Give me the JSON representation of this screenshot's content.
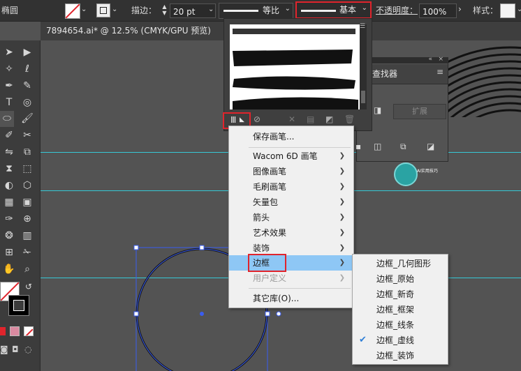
{
  "control_bar": {
    "app_fragment": "椭圆",
    "stroke_label": "描边：",
    "stroke_value": "20 pt",
    "profile_label": "等比",
    "brush_label": "基本",
    "opacity_label": "不透明度：",
    "opacity_value": "100%",
    "style_label": "样式："
  },
  "document_tab": {
    "title": "7894654.ai* @ 12.5% (CMYK/GPU 预览)"
  },
  "finder_panel": {
    "title": "查找器",
    "expand_label": "扩展",
    "logo_text": "AI实用技巧"
  },
  "brush_menu": {
    "items": [
      {
        "label": "保存画笔...",
        "submenu": false
      },
      {
        "label": "Wacom 6D 画笔",
        "submenu": true
      },
      {
        "label": "图像画笔",
        "submenu": true
      },
      {
        "label": "毛刷画笔",
        "submenu": true
      },
      {
        "label": "矢量包",
        "submenu": true
      },
      {
        "label": "箭头",
        "submenu": true
      },
      {
        "label": "艺术效果",
        "submenu": true
      },
      {
        "label": "装饰",
        "submenu": true
      },
      {
        "label": "边框",
        "submenu": true
      },
      {
        "label": "用户定义",
        "submenu": true
      },
      {
        "label": "其它库(O)...",
        "submenu": false
      }
    ]
  },
  "border_submenu": {
    "items": [
      {
        "label": "边框_几何图形",
        "checked": false
      },
      {
        "label": "边框_原始",
        "checked": false
      },
      {
        "label": "边框_新奇",
        "checked": false
      },
      {
        "label": "边框_框架",
        "checked": false
      },
      {
        "label": "边框_线条",
        "checked": false
      },
      {
        "label": "边框_虚线",
        "checked": true
      },
      {
        "label": "边框_装饰",
        "checked": false
      }
    ]
  },
  "colors": {
    "accent_guide": "#36c9d6",
    "highlight": "#8ec7f5",
    "callout_red": "#e0242c",
    "selection_blue": "#3a5df0"
  }
}
